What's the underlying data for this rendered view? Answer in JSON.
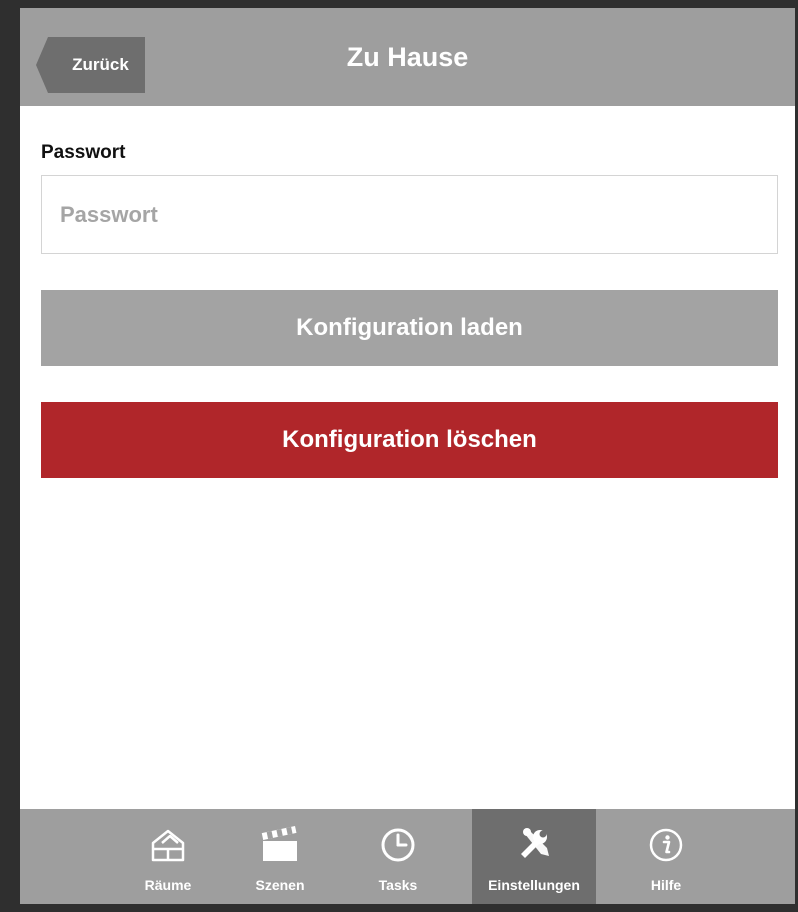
{
  "header": {
    "back_label": "Zurück",
    "title": "Zu Hause"
  },
  "form": {
    "password_label": "Passwort",
    "password_placeholder": "Passwort",
    "password_value": ""
  },
  "buttons": {
    "load_label": "Konfiguration laden",
    "delete_label": "Konfiguration löschen"
  },
  "tabbar": {
    "items": [
      {
        "label": "Räume",
        "icon": "house-icon"
      },
      {
        "label": "Szenen",
        "icon": "clapperboard-icon"
      },
      {
        "label": "Tasks",
        "icon": "clock-icon"
      },
      {
        "label": "Einstellungen",
        "icon": "tools-icon",
        "active": true
      },
      {
        "label": "Hilfe",
        "icon": "info-icon"
      }
    ]
  },
  "colors": {
    "header_bg": "#9e9e9e",
    "active_tab_bg": "#6e6e6e",
    "load_button_bg": "#a3a3a3",
    "delete_button_bg": "#b0262a"
  }
}
